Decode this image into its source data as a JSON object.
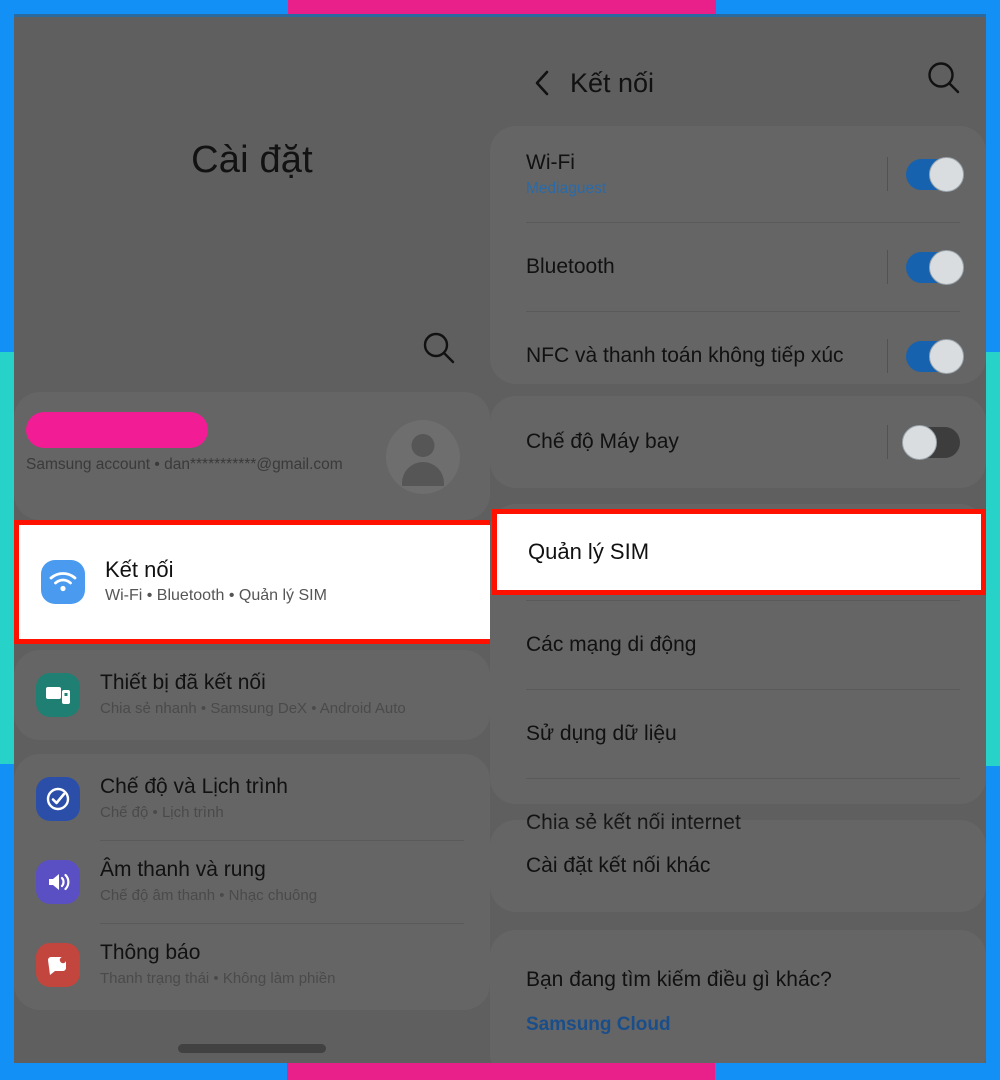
{
  "frame": {
    "blue": "#1290F5",
    "pink": "#E9208A",
    "teal": "#27D3C8",
    "highlight_red": "#FF1100"
  },
  "left_screen": {
    "title": "Cài đặt",
    "search_icon": "search-icon",
    "account": {
      "name_redacted": "",
      "subtitle": "Samsung account • dan***********@gmail.com"
    },
    "highlighted_item": {
      "icon": "wifi-icon",
      "title": "Kết nối",
      "subtitle": "Wi-Fi • Bluetooth • Quản lý SIM"
    },
    "menu_groups": [
      {
        "items": [
          {
            "icon": "connected-devices-icon",
            "title": "Thiết bị đã kết nối",
            "subtitle": "Chia sẻ nhanh • Samsung DeX • Android Auto"
          }
        ]
      },
      {
        "items": [
          {
            "icon": "modes-routines-icon",
            "title": "Chế độ và Lịch trình",
            "subtitle": "Chế độ • Lịch trình"
          },
          {
            "icon": "sound-vibration-icon",
            "title": "Âm thanh và rung",
            "subtitle": "Chế độ âm thanh • Nhạc chuông"
          },
          {
            "icon": "notifications-icon",
            "title": "Thông báo",
            "subtitle": "Thanh trạng thái • Không làm phiền"
          }
        ]
      }
    ]
  },
  "right_screen": {
    "back_icon": "chevron-left-icon",
    "title": "Kết nối",
    "search_icon": "search-icon",
    "group1": [
      {
        "label": "Wi-Fi",
        "sub": "Mediaguest",
        "toggle": "on"
      },
      {
        "label": "Bluetooth",
        "sub": "",
        "toggle": "on"
      },
      {
        "label": "NFC và thanh toán không tiếp xúc",
        "sub": "",
        "toggle": "on"
      }
    ],
    "group2": [
      {
        "label": "Chế độ Máy bay",
        "sub": "",
        "toggle": "off"
      }
    ],
    "highlighted_item": {
      "label": "Quản lý SIM"
    },
    "group3": [
      {
        "label": "Các mạng di động"
      },
      {
        "label": "Sử dụng dữ liệu"
      },
      {
        "label": "Chia sẻ kết nối internet"
      }
    ],
    "group4": [
      {
        "label": "Cài đặt kết nối khác"
      }
    ],
    "footer": {
      "question": "Bạn đang tìm kiếm điều gì khác?",
      "link": "Samsung Cloud"
    }
  }
}
